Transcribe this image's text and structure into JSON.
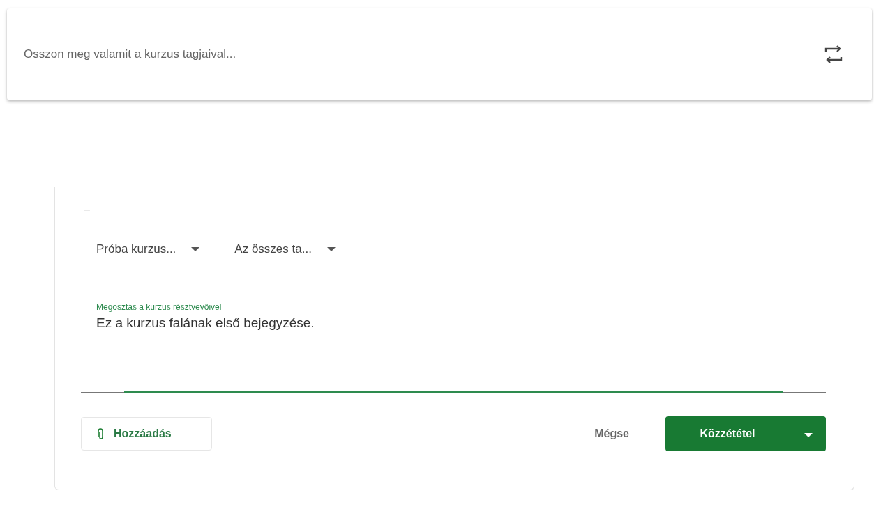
{
  "share_box": {
    "placeholder": "Osszon meg valamit a kurzus tagjaival..."
  },
  "composer": {
    "mark": "–",
    "selects": [
      {
        "label": "Próba kurzus..."
      },
      {
        "label": "Az összes ta..."
      }
    ],
    "field": {
      "label": "Megosztás a kurzus résztvevőivel",
      "value": "Ez a kurzus falának első bejegyzése.",
      "focused": true
    },
    "add_button": "Hozzáadás",
    "cancel_button": "Mégse",
    "post_button": "Közzététel"
  }
}
